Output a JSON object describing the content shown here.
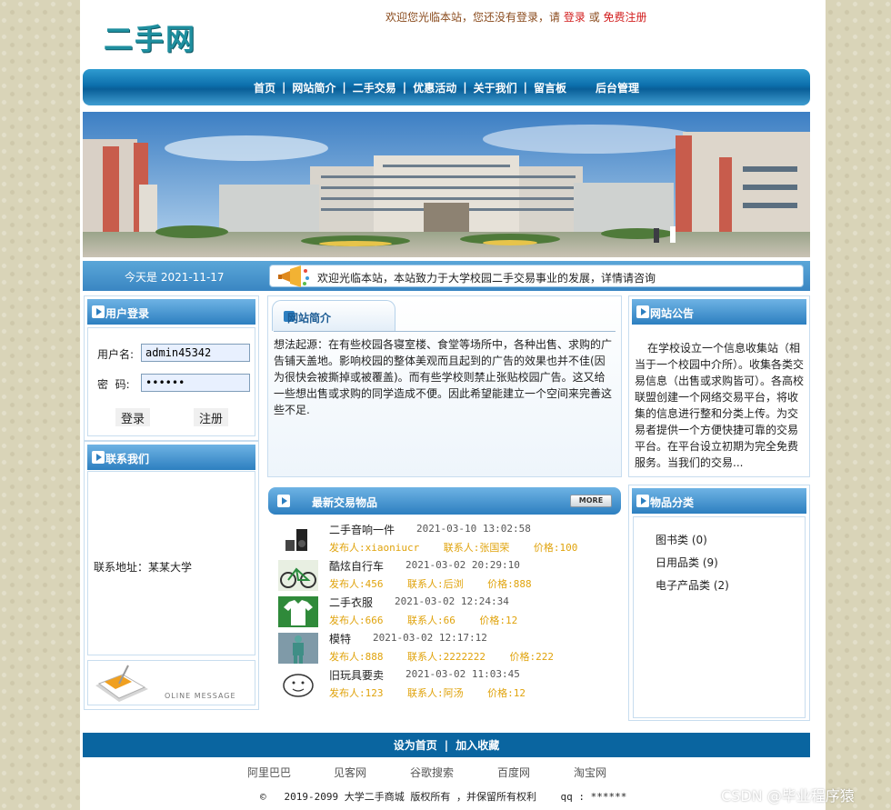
{
  "header": {
    "logo_text": "二手网",
    "welcome_prefix": "欢迎您光临本站，您还没有登录，请",
    "login_link": "登录",
    "or_text": "或",
    "register_link": "免费注册"
  },
  "nav": {
    "items": [
      "首页",
      "网站简介",
      "二手交易",
      "优惠活动",
      "关于我们",
      "留言板",
      "后台管理"
    ],
    "separator": "|"
  },
  "infobar": {
    "today": "今天是 2021-11-17",
    "notice": "欢迎光临本站，本站致力于大学校园二手交易事业的发展，详情请咨询"
  },
  "login_panel": {
    "title": "用户登录",
    "username_label": "用户名:",
    "username_value": "admin45342",
    "password_label": "密  码:",
    "password_value": "••••••",
    "login_button": "登录",
    "register_button": "注册"
  },
  "contact_panel": {
    "title": "联系我们",
    "address": "联系地址：某某大学",
    "online_message": "OLINE MESSAGE"
  },
  "intro_panel": {
    "title": "网站简介",
    "body": "想法起源：在有些校园各寝室楼、食堂等场所中，各种出售、求购的广告铺天盖地。影响校园的整体美观而且起到的广告的效果也并不佳(因为很快会被撕掉或被覆盖)。而有些学校则禁止张贴校园广告。这又给一些想出售或求购的同学造成不便。因此希望能建立一个空间来完善这些不足."
  },
  "latest": {
    "title": "最新交易物品",
    "more_label": "MORE",
    "items": [
      {
        "name": "二手音响一件",
        "time": "2021-03-10 13:02:58",
        "publisher": "发布人:xiaoniucr",
        "contact": "联系人:张国荣",
        "price": "价格:100"
      },
      {
        "name": "酷炫自行车",
        "time": "2021-03-02 20:29:10",
        "publisher": "发布人:456",
        "contact": "联系人:后浏",
        "price": "价格:888"
      },
      {
        "name": "二手衣服",
        "time": "2021-03-02 12:24:34",
        "publisher": "发布人:666",
        "contact": "联系人:66",
        "price": "价格:12"
      },
      {
        "name": "模特",
        "time": "2021-03-02 12:17:12",
        "publisher": "发布人:888",
        "contact": "联系人:2222222",
        "price": "价格:222"
      },
      {
        "name": "旧玩具要卖",
        "time": "2021-03-02 11:03:45",
        "publisher": "发布人:123",
        "contact": "联系人:阿汤",
        "price": "价格:12"
      }
    ]
  },
  "notice_panel": {
    "title": "网站公告",
    "body": "在学校设立一个信息收集站（相当于一个校园中介所）。收集各类交易信息（出售或求购皆可）。各高校联盟创建一个网络交易平台，将收集的信息进行整和分类上传。为交易者提供一个方便快捷可靠的交易平台。在平台设立初期为完全免费服务。当我们的交易..."
  },
  "category_panel": {
    "title": "物品分类",
    "items": [
      "图书类 (0)",
      "日用品类 (9)",
      "电子产品类 (2)"
    ]
  },
  "footer": {
    "set_home": "设为首页",
    "separator": "|",
    "add_favorite": "加入收藏",
    "links": [
      "阿里巴巴",
      "见客网",
      "谷歌搜索",
      "百度网",
      "淘宝网"
    ],
    "copyright_symbol": "©",
    "copyright": "2019-2099 大学二手商城 版权所有 ，并保留所有权利",
    "qq": "qq : ******"
  },
  "watermark": "CSDN @毕业程序猿",
  "colors": {
    "accent_blue": "#2d7fc0",
    "logo_teal": "#1f8f9f",
    "link_red": "#d21e1e",
    "meta_orange": "#e0a30c",
    "footer_blue": "#0a65a0"
  }
}
